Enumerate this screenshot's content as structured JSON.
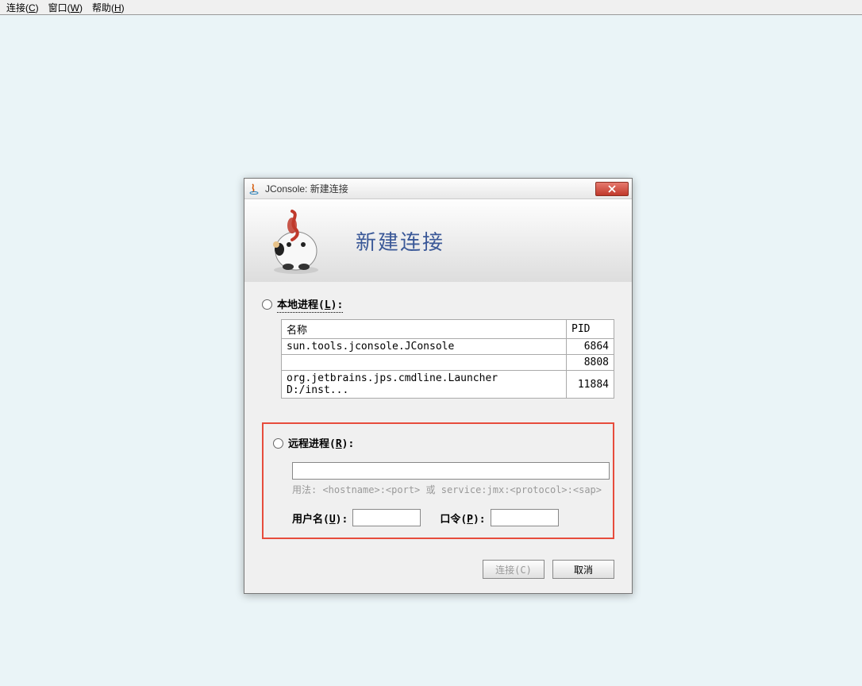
{
  "menubar": {
    "connect": "连接(",
    "connect_key": "C",
    "connect_suffix": ")",
    "window": "窗口(",
    "window_key": "W",
    "window_suffix": ")",
    "help": "帮助(",
    "help_key": "H",
    "help_suffix": ")"
  },
  "dialog": {
    "title": "JConsole: 新建连接",
    "header": "新建连接",
    "local_label_prefix": "本地进程(",
    "local_label_key": "L",
    "local_label_suffix": "):",
    "table": {
      "col_name": "名称",
      "col_pid": "PID",
      "rows": [
        {
          "name": "sun.tools.jconsole.JConsole",
          "pid": "6864"
        },
        {
          "name": "",
          "pid": "8808"
        },
        {
          "name": "org.jetbrains.jps.cmdline.Launcher D:/inst...",
          "pid": "11884"
        }
      ]
    },
    "remote_label_prefix": "远程进程(",
    "remote_label_key": "R",
    "remote_label_suffix": "):",
    "usage": "用法: <hostname>:<port> 或 service:jmx:<protocol>:<sap>",
    "username_label_prefix": "用户名(",
    "username_label_key": "U",
    "username_label_suffix": "):",
    "password_label_prefix": "口令(",
    "password_label_key": "P",
    "password_label_suffix": "):",
    "connect_btn": "连接(C)",
    "cancel_btn": "取消"
  }
}
